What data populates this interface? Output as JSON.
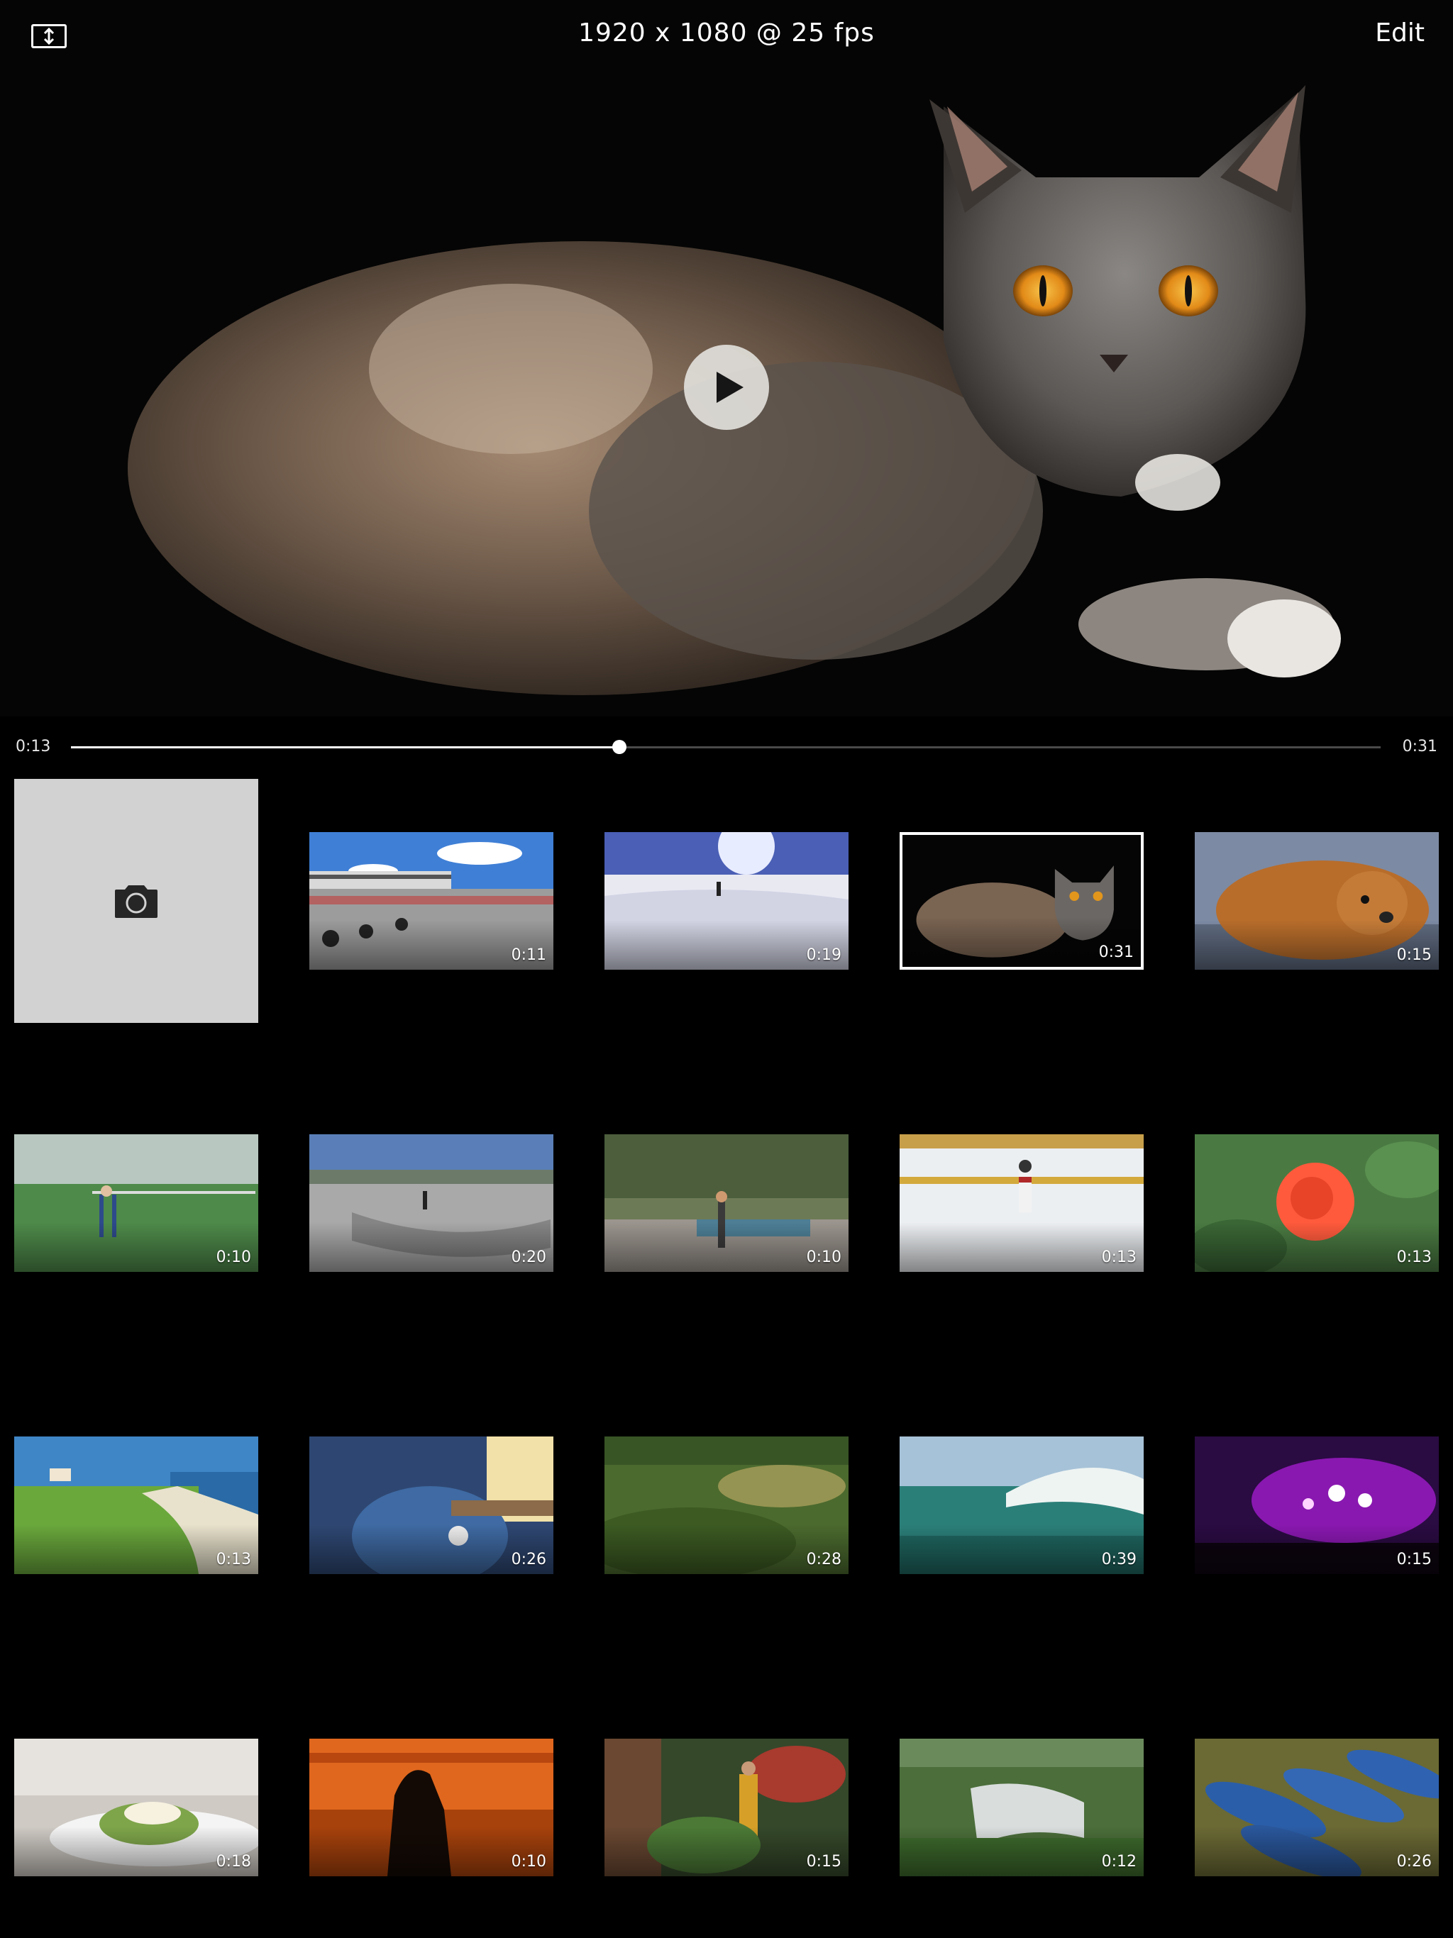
{
  "header": {
    "title": "1920 x 1080 @ 25 fps",
    "edit_label": "Edit",
    "mode_icon": "resize-vertical-icon"
  },
  "player": {
    "subject": "cat-portrait",
    "play_icon": "play-icon"
  },
  "scrubber": {
    "current_time": "0:13",
    "total_time": "0:31",
    "progress": 0.419
  },
  "camera_tile": {
    "icon": "camera-icon",
    "background": "#d2d2d2"
  },
  "videos": [
    {
      "name": "race-track",
      "duration": "0:11",
      "selected": false
    },
    {
      "name": "skiing",
      "duration": "0:19",
      "selected": false
    },
    {
      "name": "cat",
      "duration": "0:31",
      "selected": true
    },
    {
      "name": "dog",
      "duration": "0:15",
      "selected": false
    },
    {
      "name": "padel-tennis",
      "duration": "0:10",
      "selected": false
    },
    {
      "name": "skatepark",
      "duration": "0:20",
      "selected": false
    },
    {
      "name": "ping-pong",
      "duration": "0:10",
      "selected": false
    },
    {
      "name": "ice-hockey",
      "duration": "0:13",
      "selected": false
    },
    {
      "name": "rose",
      "duration": "0:13",
      "selected": false
    },
    {
      "name": "golf-coast",
      "duration": "0:13",
      "selected": false
    },
    {
      "name": "guitar",
      "duration": "0:26",
      "selected": false
    },
    {
      "name": "meadow",
      "duration": "0:28",
      "selected": false
    },
    {
      "name": "wave",
      "duration": "0:39",
      "selected": false
    },
    {
      "name": "concert",
      "duration": "0:15",
      "selected": false
    },
    {
      "name": "food",
      "duration": "0:18",
      "selected": false
    },
    {
      "name": "sunset-silhouette",
      "duration": "0:10",
      "selected": false
    },
    {
      "name": "garden",
      "duration": "0:15",
      "selected": false
    },
    {
      "name": "waterfall",
      "duration": "0:12",
      "selected": false
    },
    {
      "name": "rowboats",
      "duration": "0:26",
      "selected": false
    }
  ],
  "colors": {
    "background": "#000000",
    "track": "#4a4a4a",
    "track_fill": "#ffffff",
    "selection_border": "#ffffff"
  }
}
